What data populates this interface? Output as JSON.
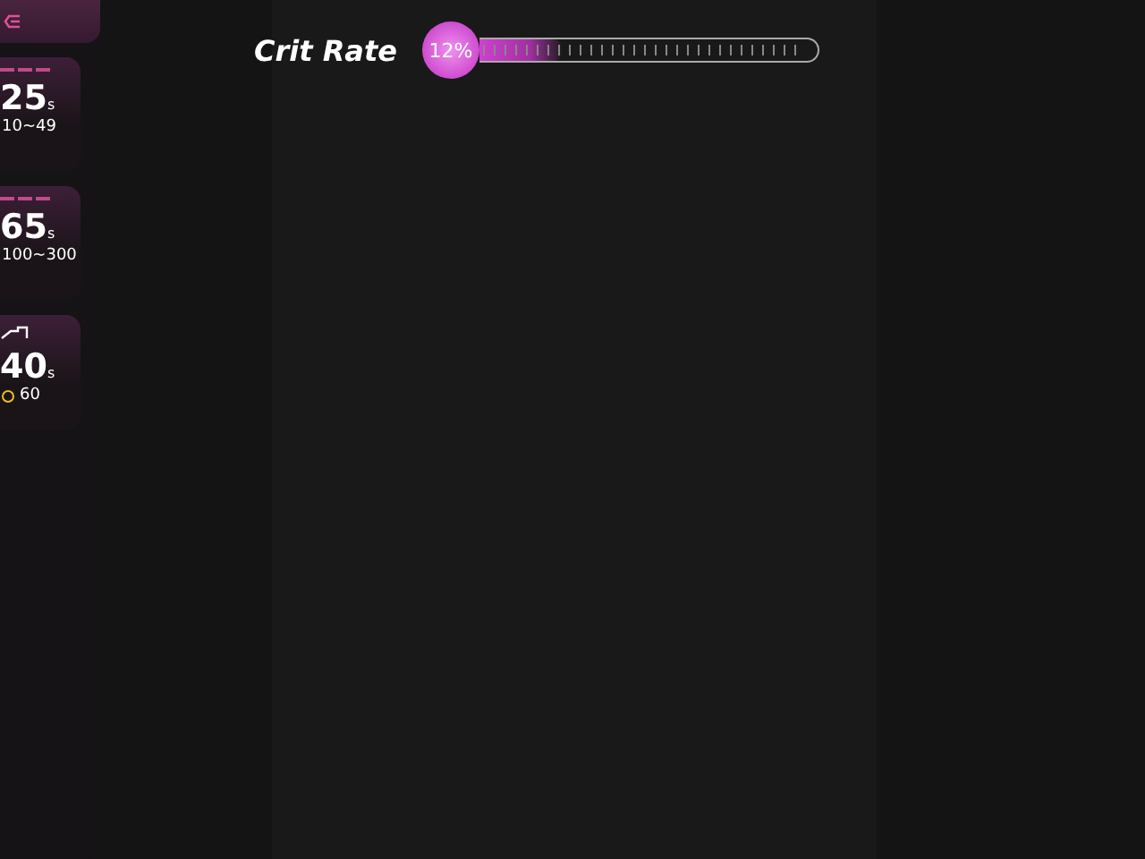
{
  "stat_cards": [
    {
      "value": "25",
      "unit": "s",
      "range": "10~49",
      "kind": "range"
    },
    {
      "value": "65",
      "unit": "s",
      "range": "100~300",
      "kind": "range"
    },
    {
      "value": "40",
      "unit": "s",
      "range": "60",
      "kind": "coin"
    }
  ],
  "slider": {
    "label": "Crit Rate",
    "reading": "12%",
    "level": 0.25
  }
}
